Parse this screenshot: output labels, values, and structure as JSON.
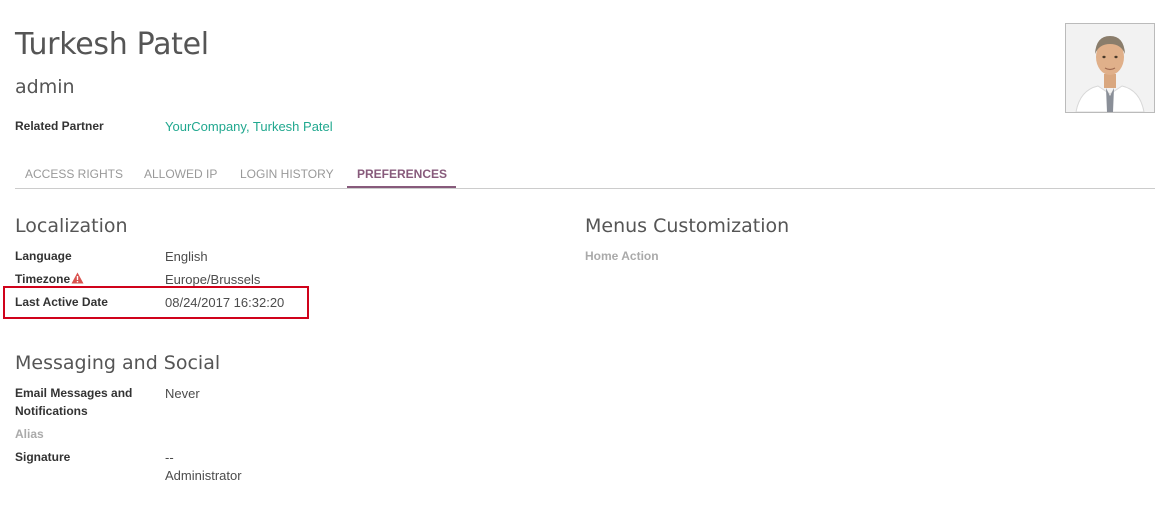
{
  "user": {
    "name": "Turkesh Patel",
    "login": "admin"
  },
  "related_partner": {
    "label": "Related Partner",
    "value": "YourCompany, Turkesh Patel"
  },
  "tabs": [
    {
      "label": "ACCESS RIGHTS"
    },
    {
      "label": "ALLOWED IP"
    },
    {
      "label": "LOGIN HISTORY"
    },
    {
      "label": "PREFERENCES"
    }
  ],
  "active_tab": "PREFERENCES",
  "localization": {
    "title": "Localization",
    "language_label": "Language",
    "language_value": "English",
    "timezone_label": "Timezone",
    "timezone_value": "Europe/Brussels",
    "last_active_label": "Last Active Date",
    "last_active_value": "08/24/2017 16:32:20"
  },
  "menus": {
    "title": "Menus Customization",
    "home_action_label": "Home Action"
  },
  "messaging": {
    "title": "Messaging and Social",
    "email_label_line1": "Email Messages and",
    "email_label_line2": "Notifications",
    "email_value": "Never",
    "alias_label": "Alias",
    "signature_label": "Signature",
    "signature_line1": "--",
    "signature_line2": "Administrator"
  },
  "colors": {
    "accent": "#875a7b",
    "link": "#21a88f",
    "warning": "#d9534f",
    "highlight": "#d0021b"
  },
  "icons": {
    "timezone_warning": "warning-icon",
    "avatar": "avatar-photo"
  }
}
